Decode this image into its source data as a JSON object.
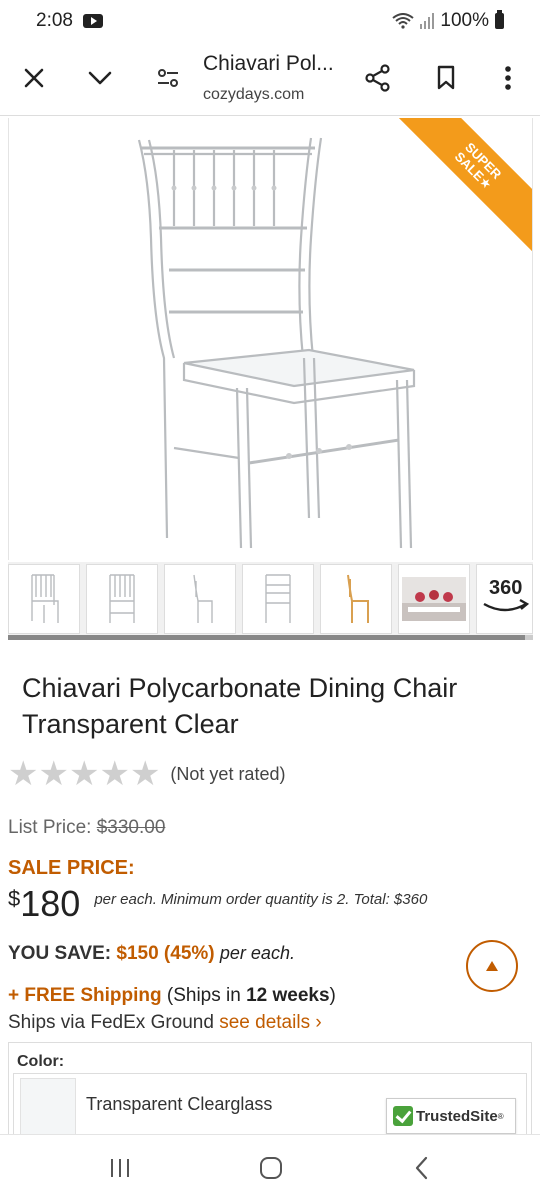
{
  "status": {
    "time": "2:08",
    "battery": "100%"
  },
  "toolbar": {
    "title": "Chiavari Pol...",
    "domain": "cozydays.com"
  },
  "hero": {
    "ribbon_line1": "SUPER",
    "ribbon_line2": "SALE★"
  },
  "thumbnails": {
    "label_360": "360"
  },
  "product": {
    "title": "Chiavari Polycarbonate Dining Chair Transparent Clear",
    "rating_text": "(Not yet rated)",
    "stars": 0,
    "list_price_label": "List Price:",
    "list_price_value": "$330.00",
    "sale_label": "SALE PRICE:",
    "price_currency": "$",
    "price_value": "180",
    "price_note": "per each. Minimum order quantity is 2. Total: $360",
    "you_save_label": "YOU SAVE:",
    "you_save_amount": "$150 (45%)",
    "you_save_suffix": "per each.",
    "free_shipping": "+ FREE Shipping",
    "ship_note_pre": "(Ships in ",
    "ship_weeks": "12 weeks",
    "ship_note_post": ")",
    "ships_via": "Ships via FedEx Ground",
    "see_details": "see details ›"
  },
  "color": {
    "label": "Color:",
    "option_name": "Transparent Clearglass"
  },
  "trusted_site": {
    "label": "TrustedSite",
    "mark": "®"
  },
  "colors": {
    "accent": "#c15c00",
    "ribbon": "#f39b1b",
    "trusted_green": "#4aa23b"
  }
}
